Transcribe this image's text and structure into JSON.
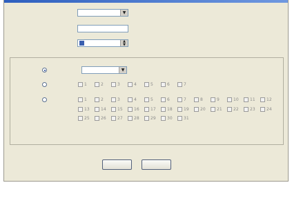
{
  "form": {
    "frequency_label": "",
    "frequency_value": "",
    "interval_label": "",
    "interval_value": "",
    "start_time_label": "",
    "start_time_value": ""
  },
  "repeat_group": {
    "legend": "",
    "option_date_label": "",
    "date_value": "",
    "option_weekly_label": "",
    "option_monthly_label": "",
    "weekdays": [
      "1",
      "2",
      "3",
      "4",
      "5",
      "6",
      "7"
    ],
    "month_days": [
      "1",
      "2",
      "3",
      "4",
      "5",
      "6",
      "7",
      "8",
      "9",
      "10",
      "11",
      "12",
      "13",
      "14",
      "15",
      "16",
      "17",
      "18",
      "19",
      "20",
      "21",
      "22",
      "23",
      "24",
      "25",
      "26",
      "27",
      "28",
      "29",
      "30",
      "31"
    ],
    "selected_option": "date"
  },
  "buttons": {
    "ok_label": "",
    "cancel_label": ""
  }
}
